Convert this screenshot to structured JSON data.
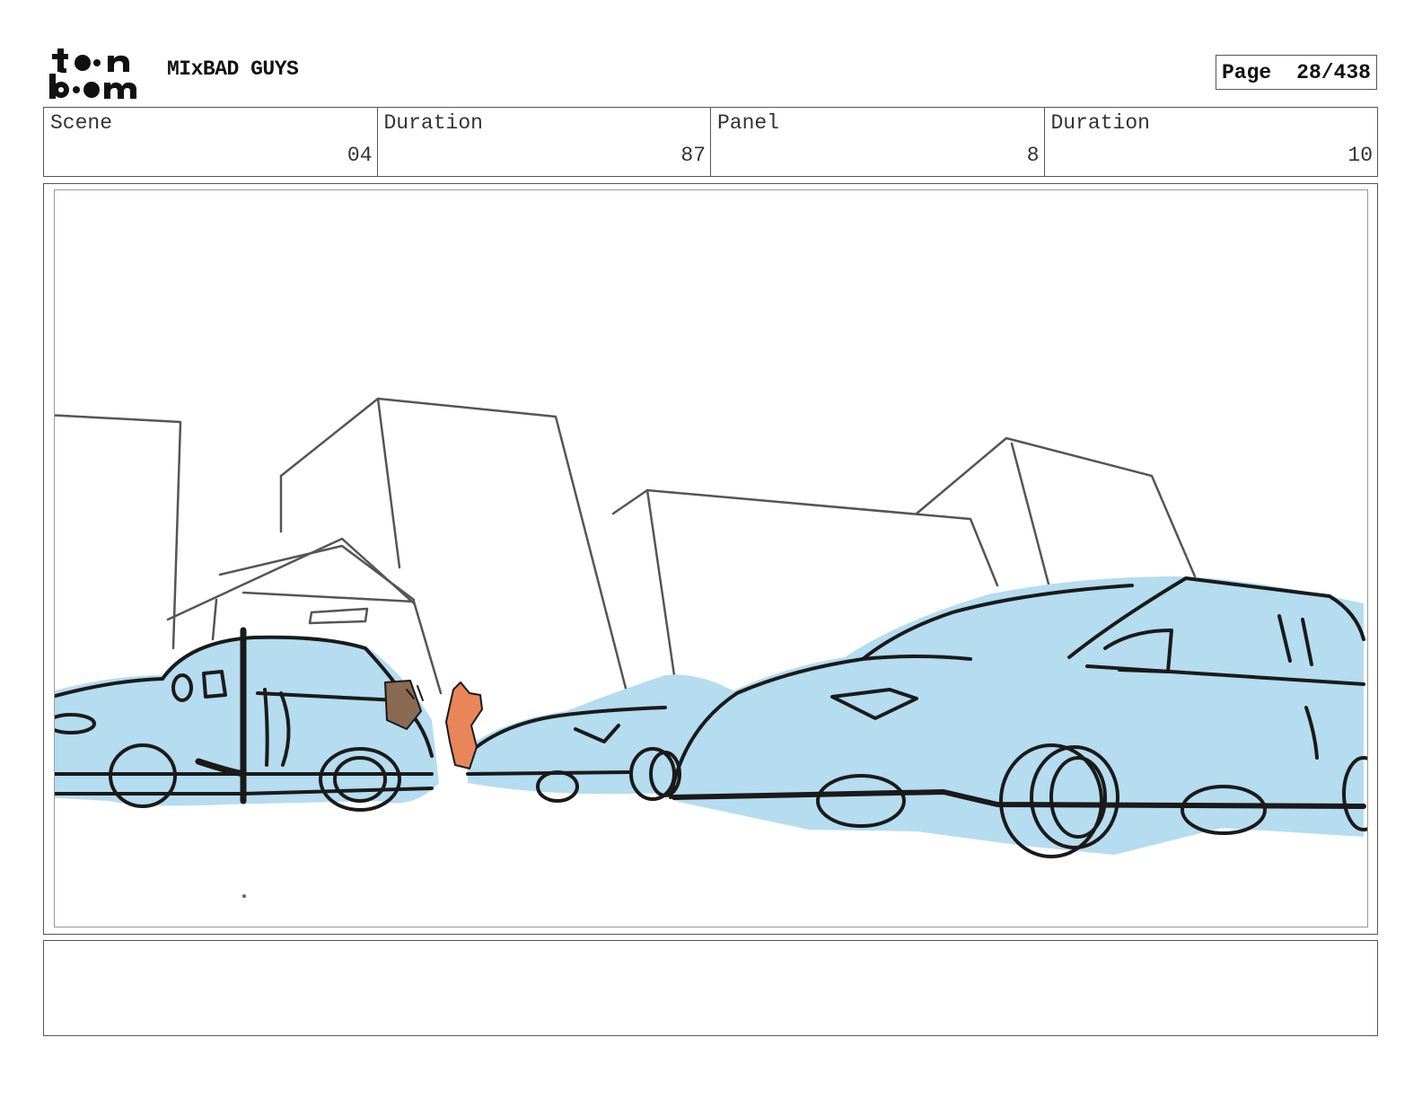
{
  "header": {
    "logo_top": "t●●n",
    "logo_bottom": "b●●m",
    "project_title": "MIxBAD GUYS",
    "page_label": "Page",
    "page_value": "28/438"
  },
  "info": {
    "scene_label": "Scene",
    "scene_value": "04",
    "scene_duration_label": "Duration",
    "scene_duration_value": "87",
    "panel_label": "Panel",
    "panel_value": "8",
    "panel_duration_label": "Duration",
    "panel_duration_value": "10"
  },
  "panel": {
    "car_fill": "#b5dcef",
    "character_colors": [
      "#e8865a",
      "#8a6a52"
    ]
  },
  "notes": {
    "text": ""
  }
}
